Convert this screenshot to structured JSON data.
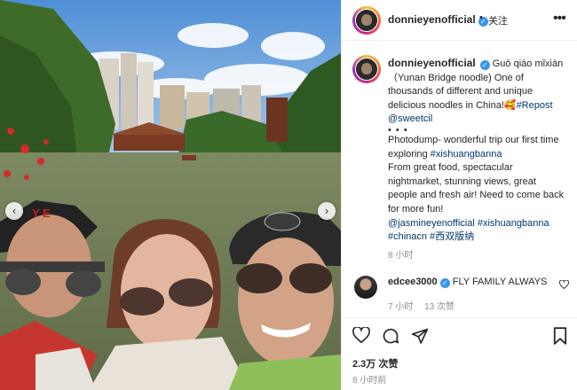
{
  "post": {
    "header": {
      "username": "donnieyenofficial",
      "separator": "•",
      "follow_label": "关注"
    },
    "caption": {
      "username": "donnieyenofficial",
      "line1": "Guō qiáo mǐxiàn",
      "line2": "（Yunan Bridge noodle) One of",
      "line3": "thousands of different and unique",
      "line4": "delicious noodles in China!🥰",
      "repost_tag": "#Repost",
      "repost_user": "@sweetcil",
      "dots": "• • •",
      "p1": "Photodump- wonderful trip our first time",
      "p2": "exploring",
      "p2_tag": "#xishuangbanna",
      "p3": "From great food, spectacular",
      "p4": "nightmarket, stunning views, great",
      "p5": "people and fresh air! Need to come back",
      "p6": "for more fun!",
      "m1_user": "@jasmineyenofficial",
      "m1_tag": "#xishuangbanna",
      "m2_tag1": "#chinacn",
      "m2_tag2": "#西双版纳"
    },
    "caption_time": "8 小时",
    "comment": {
      "username": "edcee3000",
      "text": "FLY FAMILY ALWAYS",
      "time": "7 小时",
      "likes": "13 次赞"
    },
    "likes": "2.3万 次赞",
    "time": "8 小时前"
  },
  "photo": {
    "prev_glyph": "‹",
    "next_glyph": "›",
    "cap_text": "Y E"
  },
  "icons": {
    "verified": "✓",
    "more": "•••"
  },
  "colors": {
    "link": "#00376b",
    "verified": "#3897f0",
    "muted": "#8e8e8e"
  }
}
